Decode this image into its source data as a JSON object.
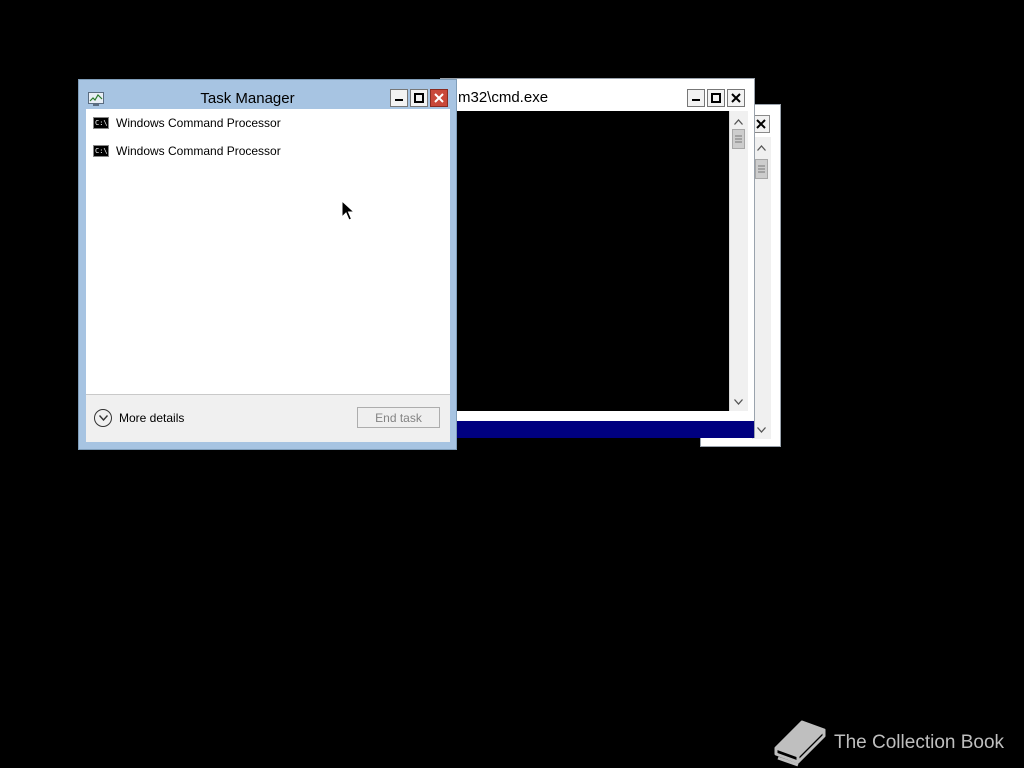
{
  "cmd_back": {
    "close_glyph": "✕"
  },
  "cmd_front": {
    "title": "m32\\cmd.exe",
    "buttons": [
      "minimize-icon",
      "maximize-icon",
      "close-icon"
    ],
    "statusbar_color": "#000080"
  },
  "task_manager": {
    "title": "Task Manager",
    "processes": [
      {
        "name": "Windows Command Processor",
        "icon": "cmd-icon",
        "icon_text": "C:\\"
      },
      {
        "name": "Windows Command Processor",
        "icon": "cmd-icon",
        "icon_text": "C:\\"
      }
    ],
    "more_details_label": "More details",
    "end_task_label": "End task",
    "close_color": "#c9483a"
  },
  "watermark": {
    "text": "The Collection Book",
    "icon": "book-icon"
  }
}
